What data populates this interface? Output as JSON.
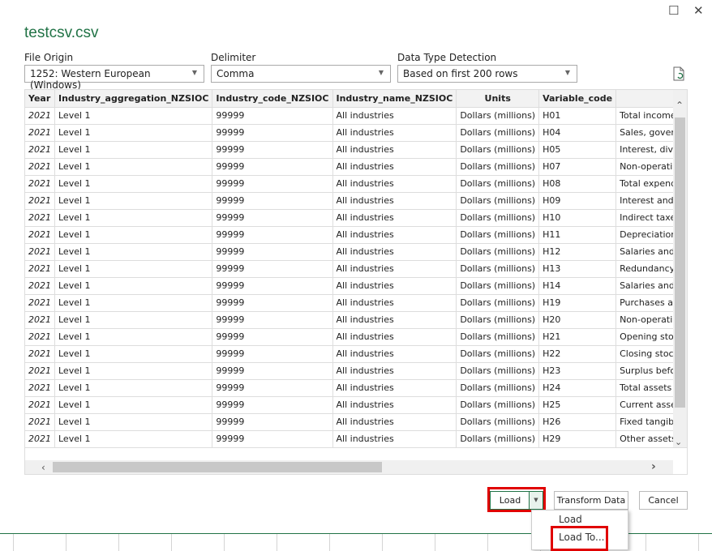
{
  "window": {
    "title": "testcsv.csv",
    "maximize_icon": "square-icon",
    "close_icon": "x-icon"
  },
  "options": {
    "file_origin": {
      "label": "File Origin",
      "value": "1252: Western European (Windows)"
    },
    "delimiter": {
      "label": "Delimiter",
      "value": "Comma"
    },
    "detection": {
      "label": "Data Type Detection",
      "value": "Based on first 200 rows"
    },
    "refresh_icon": "file-refresh-icon"
  },
  "table": {
    "headers": [
      "Year",
      "Industry_aggregation_NZSIOC",
      "Industry_code_NZSIOC",
      "Industry_name_NZSIOC",
      "Units",
      "Variable_code",
      "Va"
    ],
    "rows": [
      [
        "2021",
        "Level 1",
        "99999",
        "All industries",
        "Dollars (millions)",
        "H01",
        "Total income"
      ],
      [
        "2021",
        "Level 1",
        "99999",
        "All industries",
        "Dollars (millions)",
        "H04",
        "Sales, government fu"
      ],
      [
        "2021",
        "Level 1",
        "99999",
        "All industries",
        "Dollars (millions)",
        "H05",
        "Interest, dividends ar"
      ],
      [
        "2021",
        "Level 1",
        "99999",
        "All industries",
        "Dollars (millions)",
        "H07",
        "Non-operating incom"
      ],
      [
        "2021",
        "Level 1",
        "99999",
        "All industries",
        "Dollars (millions)",
        "H08",
        "Total expenditure"
      ],
      [
        "2021",
        "Level 1",
        "99999",
        "All industries",
        "Dollars (millions)",
        "H09",
        "Interest and donation"
      ],
      [
        "2021",
        "Level 1",
        "99999",
        "All industries",
        "Dollars (millions)",
        "H10",
        "Indirect taxes"
      ],
      [
        "2021",
        "Level 1",
        "99999",
        "All industries",
        "Dollars (millions)",
        "H11",
        "Depreciation"
      ],
      [
        "2021",
        "Level 1",
        "99999",
        "All industries",
        "Dollars (millions)",
        "H12",
        "Salaries and wages pa"
      ],
      [
        "2021",
        "Level 1",
        "99999",
        "All industries",
        "Dollars (millions)",
        "H13",
        "Redundancy and seve"
      ],
      [
        "2021",
        "Level 1",
        "99999",
        "All industries",
        "Dollars (millions)",
        "H14",
        "Salaries and wages to"
      ],
      [
        "2021",
        "Level 1",
        "99999",
        "All industries",
        "Dollars (millions)",
        "H19",
        "Purchases and other"
      ],
      [
        "2021",
        "Level 1",
        "99999",
        "All industries",
        "Dollars (millions)",
        "H20",
        "Non-operating expen"
      ],
      [
        "2021",
        "Level 1",
        "99999",
        "All industries",
        "Dollars (millions)",
        "H21",
        "Opening stocks"
      ],
      [
        "2021",
        "Level 1",
        "99999",
        "All industries",
        "Dollars (millions)",
        "H22",
        "Closing stocks"
      ],
      [
        "2021",
        "Level 1",
        "99999",
        "All industries",
        "Dollars (millions)",
        "H23",
        "Surplus before incom"
      ],
      [
        "2021",
        "Level 1",
        "99999",
        "All industries",
        "Dollars (millions)",
        "H24",
        "Total assets"
      ],
      [
        "2021",
        "Level 1",
        "99999",
        "All industries",
        "Dollars (millions)",
        "H25",
        "Current assets"
      ],
      [
        "2021",
        "Level 1",
        "99999",
        "All industries",
        "Dollars (millions)",
        "H26",
        "Fixed tangible assets"
      ],
      [
        "2021",
        "Level 1",
        "99999",
        "All industries",
        "Dollars (millions)",
        "H29",
        "Other assets"
      ]
    ]
  },
  "buttons": {
    "load": "Load",
    "transform": "Transform Data",
    "cancel": "Cancel"
  },
  "load_menu": [
    "Load",
    "Load To..."
  ],
  "colors": {
    "accent": "#217346",
    "highlight": "#e00000"
  }
}
